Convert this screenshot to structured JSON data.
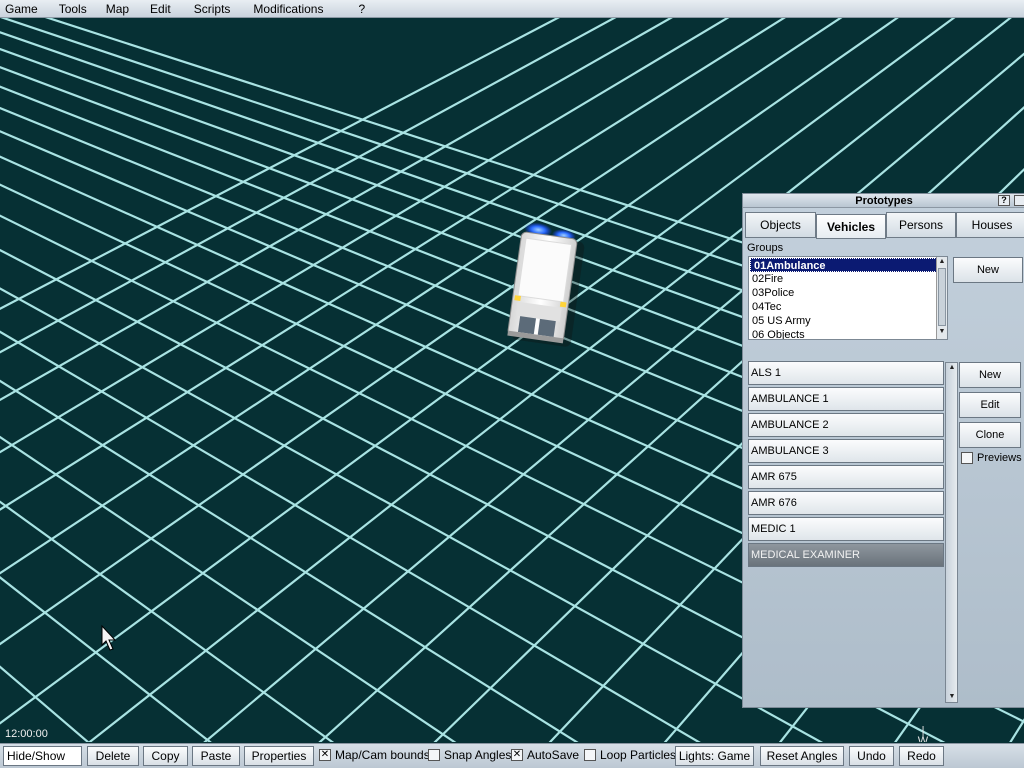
{
  "menu": {
    "items": [
      "Game",
      "Tools",
      "Map",
      "Edit",
      "Scripts",
      "Modifications",
      "?"
    ]
  },
  "viewport": {
    "clock": "12:00:00",
    "compass_letter": "W",
    "colors": {
      "ground": "#063034",
      "grid": "#a9e3e3"
    }
  },
  "panel": {
    "title": "Prototypes",
    "help_label": "?",
    "tabs": [
      "Objects",
      "Vehicles",
      "Persons",
      "Houses"
    ],
    "active_tab": "Vehicles",
    "groups_label": "Groups",
    "groups": [
      "01Ambulance",
      "02Fire",
      "03Police",
      "04Tec",
      "05 US Army",
      "06 Objects"
    ],
    "selected_group": "01Ambulance",
    "group_new_label": "New",
    "prototypes": [
      "ALS 1",
      "AMBULANCE 1",
      "AMBULANCE 2",
      "AMBULANCE 3",
      "AMR 675",
      "AMR 676",
      "MEDIC 1",
      "MEDICAL EXAMINER"
    ],
    "selected_prototype": "MEDICAL EXAMINER",
    "buttons": {
      "new": "New",
      "edit": "Edit",
      "clone": "Clone"
    },
    "previews_label": "Previews",
    "previews_checked": false
  },
  "toolbar": {
    "hide_show": "Hide/Show",
    "delete": "Delete",
    "copy": "Copy",
    "paste": "Paste",
    "properties": "Properties",
    "map_cam_bounds": "Map/Cam bounds",
    "map_cam_bounds_checked": true,
    "snap_angles": "Snap Angles",
    "snap_angles_checked": false,
    "autosave": "AutoSave",
    "autosave_checked": true,
    "loop_particles": "Loop Particles",
    "loop_particles_checked": false,
    "lights": "Lights: Game",
    "reset_angles": "Reset Angles",
    "undo": "Undo",
    "redo": "Redo"
  }
}
